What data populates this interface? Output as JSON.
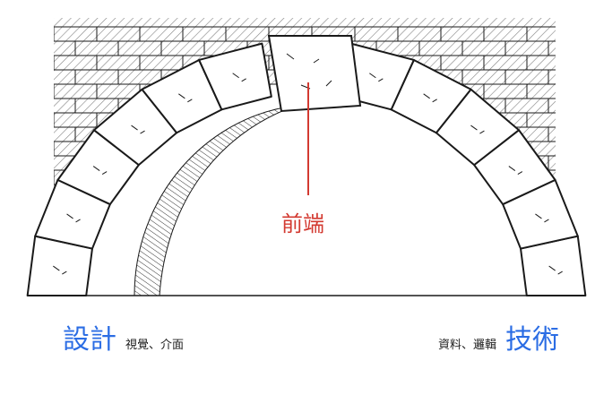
{
  "labels": {
    "center": "前端",
    "left": {
      "title": "設計",
      "subtitle": "視覺、介面"
    },
    "right": {
      "title": "技術",
      "subtitle": "資料、邏輯"
    }
  },
  "colors": {
    "accent_blue": "#2b6de4",
    "accent_red": "#d33a31",
    "ink": "#1a1a1a"
  },
  "illustration": {
    "subject": "stone-arch",
    "voussoir_count": 12
  }
}
